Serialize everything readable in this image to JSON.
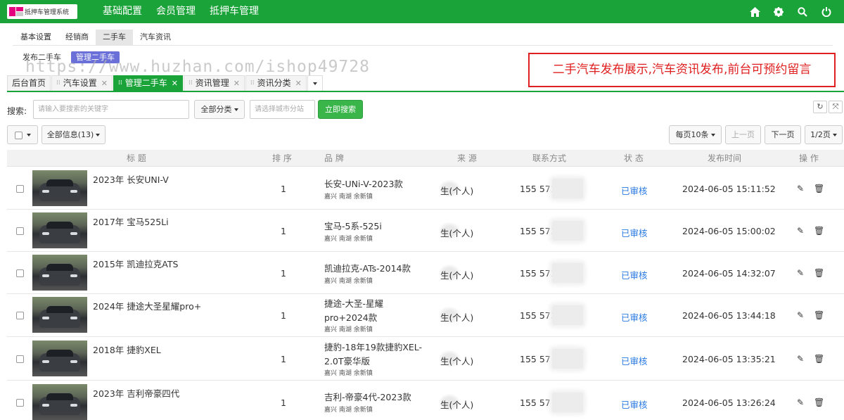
{
  "header": {
    "logo_text": "抵押车管理系统",
    "nav": [
      "基础配置",
      "会员管理",
      "抵押车管理"
    ],
    "icons": [
      "home-icon",
      "gear-icon",
      "search-icon",
      "power-icon"
    ]
  },
  "subnav": [
    "基本设置",
    "经销商",
    "二手车",
    "汽车资讯"
  ],
  "subnav_active": "二手车",
  "subsub": [
    "发布二手车",
    "管理二手车"
  ],
  "watermark": "https://www.huzhan.com/ishop49728",
  "promo": "二手汽车发布展示,汽车资讯发布,前台可预约留言",
  "tabs": [
    "后台首页",
    "汽车设置",
    "管理二手车",
    "资讯管理",
    "资讯分类"
  ],
  "search": {
    "label": "搜索:",
    "keyword_placeholder": "请输入要搜索的关键字",
    "category": "全部分类",
    "city_placeholder": "请选择城市分站",
    "submit": "立即搜索"
  },
  "toolbar": {
    "all_info": "全部信息(13)",
    "page_size": "每页10条",
    "prev": "上一页",
    "next": "下一页",
    "page": "1/2页"
  },
  "columns": [
    "标 题",
    "排 序",
    "品 牌",
    "来 源",
    "联系方式",
    "状 态",
    "发布时间",
    "操 作"
  ],
  "rows": [
    {
      "title": "2023年 长安UNI-V",
      "sort": "1",
      "brand": "长安-UNi-V-2023款",
      "loc": "嘉兴 南湖 余新镇",
      "source": "生(个人)",
      "phone": "155 573",
      "status": "已审核",
      "time": "2024-06-05 15:11:52"
    },
    {
      "title": "2017年 宝马525Li",
      "sort": "1",
      "brand": "宝马-5系-525i",
      "loc": "嘉兴 南湖 余新镇",
      "source": "生(个人)",
      "phone": "155 573",
      "status": "已审核",
      "time": "2024-06-05 15:00:02"
    },
    {
      "title": "2015年 凯迪拉克ATS",
      "sort": "1",
      "brand": "凯迪拉克-ATs-2014款",
      "loc": "嘉兴 南湖 余新镇",
      "source": "生(个人)",
      "phone": "155 573",
      "status": "已审核",
      "time": "2024-06-05 14:32:07"
    },
    {
      "title": "2024年 捷途大圣星耀pro+",
      "sort": "1",
      "brand": "捷途-大圣-星耀pro+2024款",
      "loc": "嘉兴 南湖 余新镇",
      "source": "生(个人)",
      "phone": "155 573",
      "status": "已审核",
      "time": "2024-06-05 13:44:18"
    },
    {
      "title": "2018年 捷豹XEL",
      "sort": "1",
      "brand": "捷豹-18年19款捷豹XEL-2.0T豪华版",
      "loc": "嘉兴 南湖 余新镇",
      "source": "生(个人)",
      "phone": "155 57",
      "status": "已审核",
      "time": "2024-06-05 13:35:21"
    },
    {
      "title": "2023年 吉利帝豪四代",
      "sort": "1",
      "brand": "吉利-帝豪4代-2023款",
      "loc": "嘉兴 南湖 余新镇",
      "source": "生(个人)",
      "phone": "155 57",
      "status": "已审核",
      "time": "2024-06-05 13:26:24"
    }
  ]
}
